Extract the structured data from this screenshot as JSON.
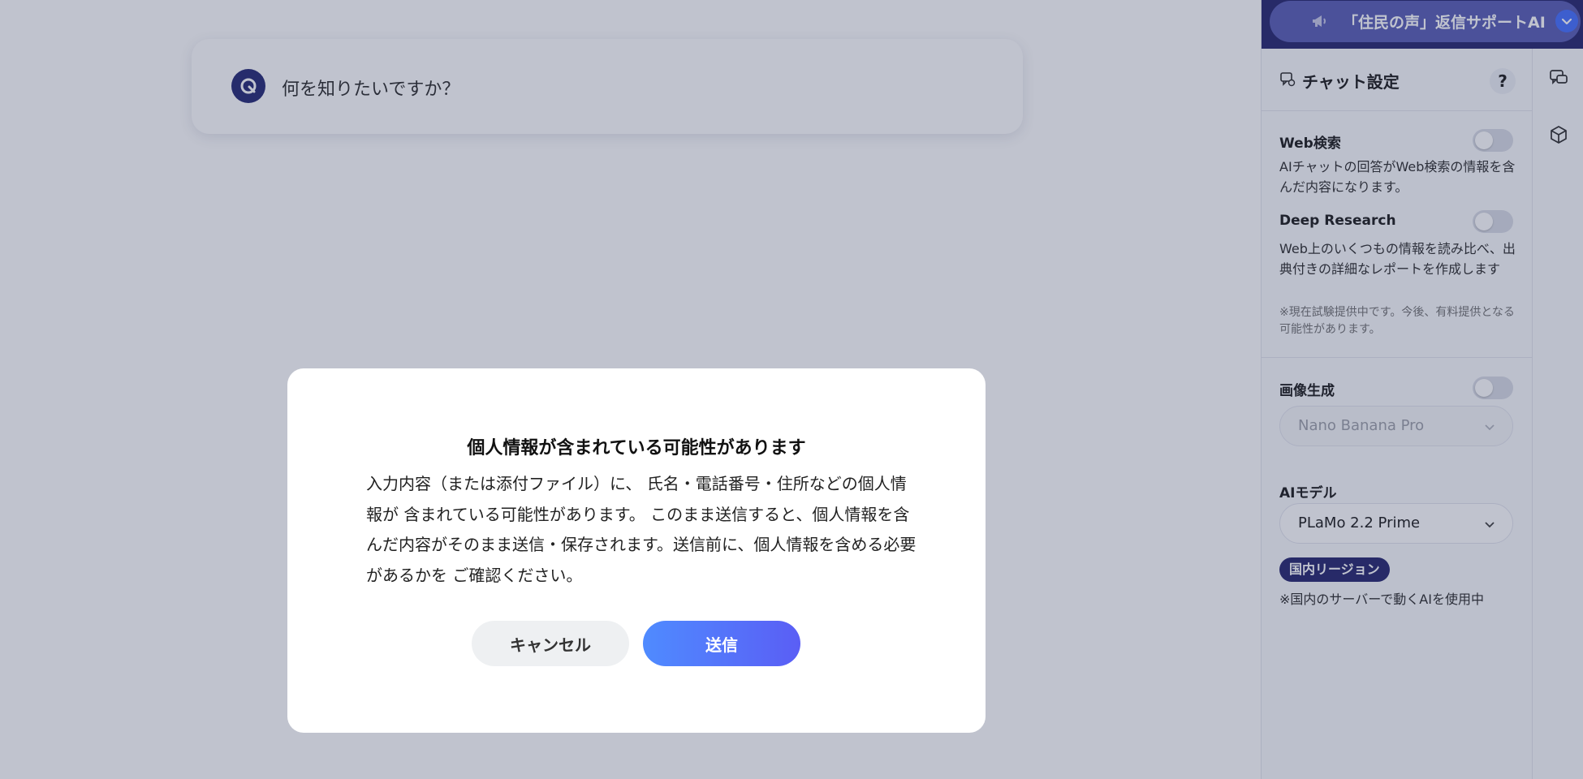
{
  "app": {
    "title": "「住民の声」返信サポートAI"
  },
  "ask": {
    "placeholder": "何を知りたいですか？"
  },
  "panel": {
    "title": "チャット設定",
    "help": "?",
    "web_search": {
      "label": "Web検索",
      "desc": "AIチャットの回答がWeb検索の情報を含んだ内容になります。",
      "enabled": false
    },
    "deep_research": {
      "label": "Deep Research",
      "desc": "Web上のいくつもの情報を読み比べ、出典付きの詳細なレポートを作成します",
      "note": "※現在試験提供中です。今後、有料提供となる可能性があります。",
      "enabled": false
    },
    "image_gen": {
      "label": "画像生成",
      "model": "Nano Banana Pro",
      "enabled": false
    },
    "ai_model": {
      "label": "AIモデル",
      "value": "PLaMo 2.2 Prime",
      "badge": "国内リージョン",
      "note": "※国内のサーバーで動くAIを使用中"
    }
  },
  "modal": {
    "title": "個人情報が含まれている可能性があります",
    "body": "入力内容（または添付ファイル）に、 氏名・電話番号・住所などの個人情報が 含まれている可能性があります。 このまま送信すると、個人情報を含んだ内容がそのまま送信・保存されます。送信前に、個人情報を含める必要があるかを ご確認ください。",
    "cancel": "キャンセル",
    "send": "送信"
  },
  "colors": {
    "accent": "#4a74ff",
    "header": "#2b2c72",
    "send_gradient_start": "#4f8bff",
    "send_gradient_end": "#5a5ef5"
  },
  "icons": [
    "q-logo-icon",
    "megaphone-icon",
    "chevron-down-icon",
    "chat-settings-icon",
    "chat-bubbles-icon",
    "cube-icon"
  ]
}
